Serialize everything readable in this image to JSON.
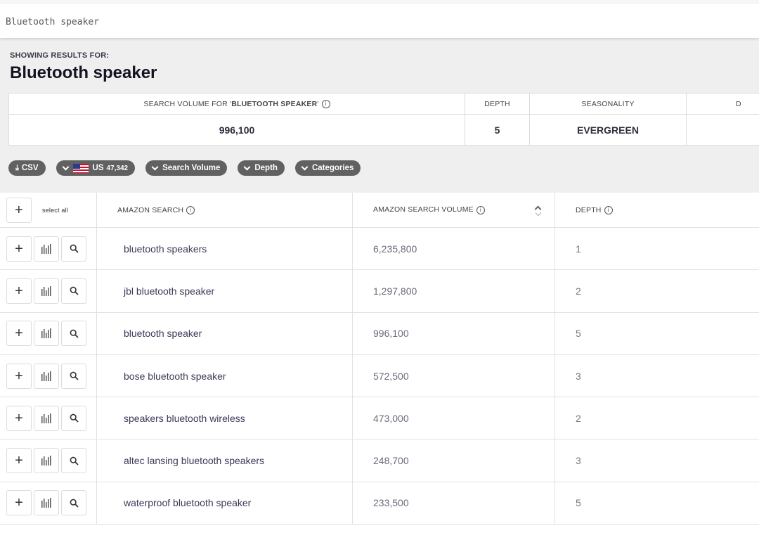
{
  "search": {
    "value": "Bluetooth speaker"
  },
  "results_header": {
    "showing_label": "SHOWING RESULTS FOR:",
    "query": "Bluetooth speaker"
  },
  "summary": {
    "search_volume_label_prefix": "SEARCH VOLUME FOR '",
    "search_volume_label_term": "BLUETOOTH SPEAKER",
    "search_volume_label_suffix": "'",
    "depth_label": "DEPTH",
    "seasonality_label": "SEASONALITY",
    "truncated_label": "D",
    "search_volume": "996,100",
    "depth": "5",
    "seasonality": "EVERGREEN"
  },
  "filters": {
    "csv": "CSV",
    "country": "US",
    "country_count": "47,342",
    "search_volume": "Search Volume",
    "depth": "Depth",
    "categories": "Categories"
  },
  "table": {
    "select_all": "select all",
    "col_search": "AMAZON SEARCH",
    "col_volume": "AMAZON SEARCH VOLUME",
    "col_depth": "DEPTH",
    "rows": [
      {
        "term": "bluetooth speakers",
        "volume": "6,235,800",
        "depth": "1"
      },
      {
        "term": "jbl bluetooth speaker",
        "volume": "1,297,800",
        "depth": "2"
      },
      {
        "term": "bluetooth speaker",
        "volume": "996,100",
        "depth": "5"
      },
      {
        "term": "bose bluetooth speaker",
        "volume": "572,500",
        "depth": "3"
      },
      {
        "term": "speakers bluetooth wireless",
        "volume": "473,000",
        "depth": "2"
      },
      {
        "term": "altec lansing bluetooth speakers",
        "volume": "248,700",
        "depth": "3"
      },
      {
        "term": "waterproof bluetooth speaker",
        "volume": "233,500",
        "depth": "5"
      }
    ]
  },
  "colors": {
    "pill_bg": "#616161",
    "panel_bg": "#efefef",
    "accent_text": "#3a3a56"
  }
}
